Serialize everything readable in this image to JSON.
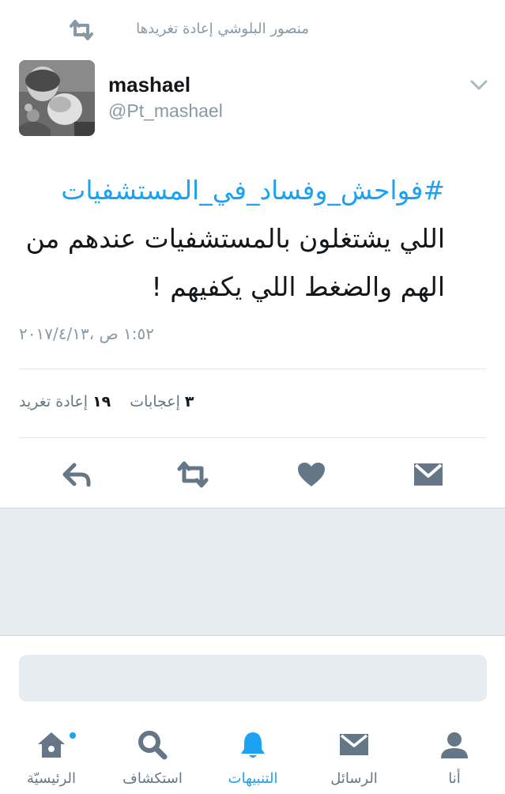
{
  "retweet_context": {
    "text": "منصور البلوشي إعادة تغريدها",
    "icon": "retweet-icon"
  },
  "author": {
    "display_name": "mashael",
    "handle": "@Pt_mashael",
    "avatar": "avatar-photo"
  },
  "tweet": {
    "hashtag": "#فواحش_وفساد_في_المستشفيات",
    "text_after_hashtag": " اللي يشتغلون بالمستشفيات عندهم من الهم والضغط اللي يكفيهم !",
    "timestamp": "١:٥٢ ص ،٢٠١٧/٤/١٣"
  },
  "stats": {
    "retweets_count": "١٩",
    "retweets_label": "إعادة تغريد",
    "likes_count": "٣",
    "likes_label": "إعجابات"
  },
  "actions": [
    "reply-icon",
    "retweet-icon",
    "heart-icon",
    "envelope-icon"
  ],
  "tabbar": {
    "items": [
      {
        "label": "الرئيسيّة",
        "icon": "home-icon",
        "active": false,
        "has_dot": true
      },
      {
        "label": "استكشاف",
        "icon": "search-icon",
        "active": false
      },
      {
        "label": "التنبيهات",
        "icon": "bell-icon",
        "active": true
      },
      {
        "label": "الرسائل",
        "icon": "envelope-icon",
        "active": false
      },
      {
        "label": "أنا",
        "icon": "person-icon",
        "active": false
      }
    ]
  },
  "colors": {
    "accent": "#1da1f2",
    "icon_gray": "#657786",
    "muted": "#8899a6",
    "panel": "#e6ecf0"
  }
}
